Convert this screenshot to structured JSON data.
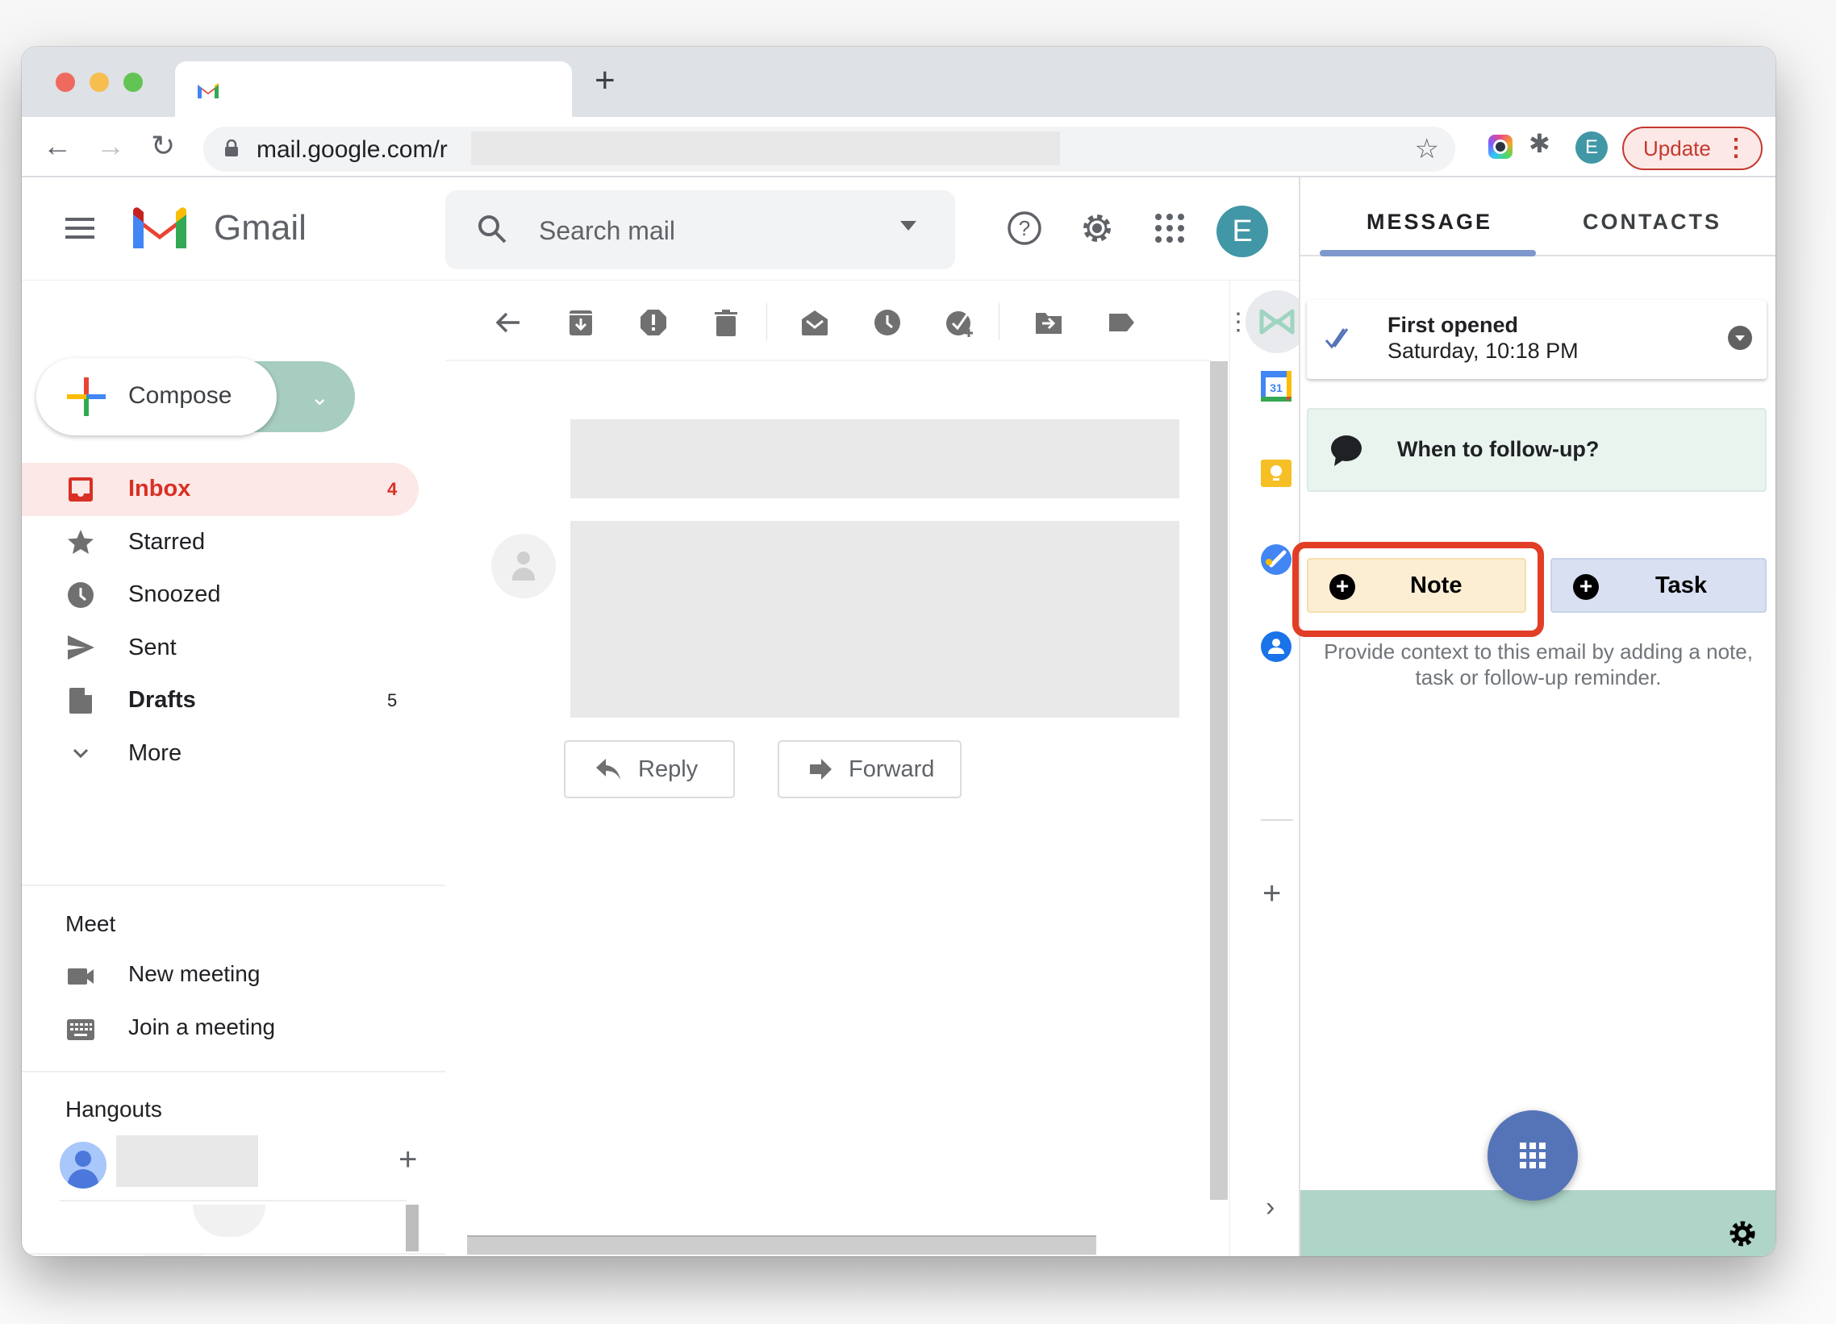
{
  "browser": {
    "tab_title": "",
    "tab_favicon": "gmail-m-icon",
    "new_tab_label": "+",
    "url": "mail.google.com/r",
    "profile_initial": "E",
    "update_label": "Update",
    "colors": {
      "update": "#c5392f",
      "profile": "#4197a6"
    }
  },
  "gmail": {
    "app_name": "Gmail",
    "search_placeholder": "Search mail",
    "avatar_initial": "E",
    "compose_label": "Compose",
    "nav": [
      {
        "label": "Inbox",
        "count": "4",
        "icon": "inbox-icon",
        "active": true
      },
      {
        "label": "Starred",
        "count": "",
        "icon": "star-icon"
      },
      {
        "label": "Snoozed",
        "count": "",
        "icon": "clock-icon"
      },
      {
        "label": "Sent",
        "count": "",
        "icon": "send-icon"
      },
      {
        "label": "Drafts",
        "count": "5",
        "icon": "draft-icon",
        "bold": true
      },
      {
        "label": "More",
        "count": "",
        "icon": "chevron-down-icon"
      }
    ],
    "meet": {
      "title": "Meet",
      "items": [
        {
          "label": "New meeting",
          "icon": "video-icon"
        },
        {
          "label": "Join a meeting",
          "icon": "keyboard-icon"
        }
      ]
    },
    "hangouts": {
      "title": "Hangouts",
      "add_label": "+"
    },
    "toolbar": [
      "back",
      "archive",
      "report-spam",
      "delete",
      "mark-unread",
      "snooze",
      "add-to-tasks",
      "move-to",
      "labels"
    ],
    "actions": {
      "reply_label": "Reply",
      "forward_label": "Forward"
    }
  },
  "panel": {
    "tabs": [
      {
        "label": "MESSAGE",
        "active": true
      },
      {
        "label": "CONTACTS",
        "active": false
      }
    ],
    "opened": {
      "title": "First opened",
      "time": "Saturday, 10:18 PM"
    },
    "followup_label": "When to follow-up?",
    "note_label": "Note",
    "task_label": "Task",
    "hint": "Provide context to this email by adding a note, task or follow-up reminder.",
    "colors": {
      "tab_indicator": "#7e97cc",
      "followup_bg": "#e9f4ef",
      "note_bg": "#fbeed3",
      "task_bg": "#d9e0f1",
      "footer_bg": "#afd5c8",
      "fab": "#5574b8",
      "highlight": "#e23e26"
    }
  }
}
